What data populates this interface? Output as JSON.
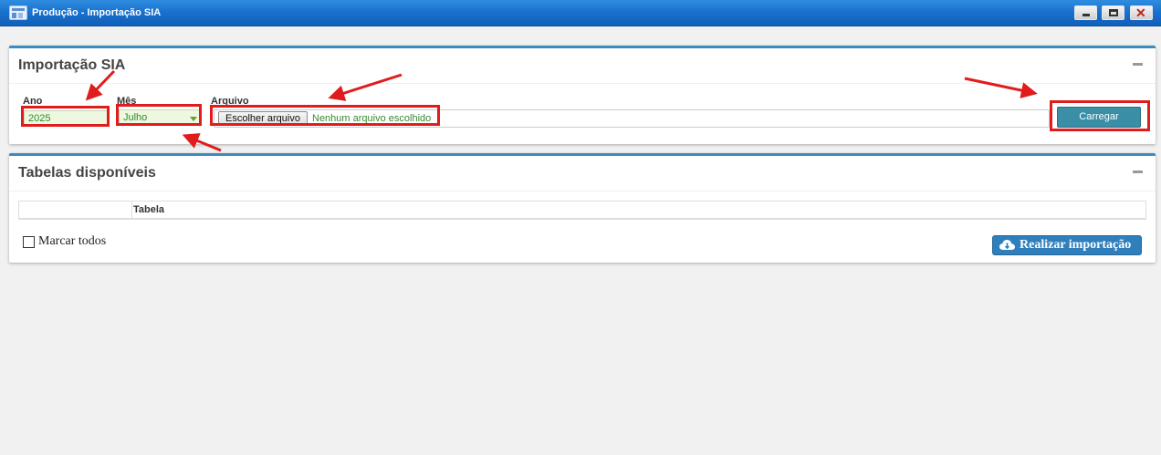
{
  "window": {
    "title": "Produção - Importação SIA",
    "icon": "app-window-icon",
    "controls": [
      "minimize-icon",
      "maximize-icon",
      "close-icon"
    ],
    "close_glyph": "✕"
  },
  "import_panel": {
    "title": "Importação SIA",
    "ano": {
      "label": "Ano",
      "value": "2025"
    },
    "mes": {
      "label": "Mês",
      "value": "Julho"
    },
    "arquivo": {
      "label": "Arquivo",
      "button_label": "Escolher arquivo",
      "status": "Nenhum arquivo escolhido"
    },
    "load_button": "Carregar"
  },
  "tables_panel": {
    "title": "Tabelas disponíveis",
    "columns": [
      "",
      "Tabela"
    ],
    "select_all_label": "Marcar todos",
    "import_button": "Realizar importação"
  },
  "annotation_color": "#e01c1c"
}
